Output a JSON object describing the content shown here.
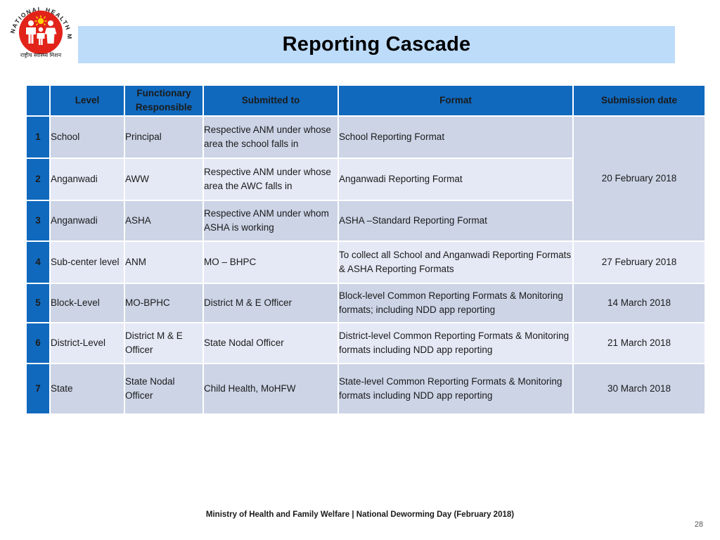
{
  "logo": {
    "name": "national-health-mission-logo",
    "arc_text": "NATIONAL HEALTH MISSION",
    "hindi_text": "राष्ट्रीय स्वास्थ्य मिशन",
    "colors": {
      "circle": "#e2231a",
      "figures": "#ffffff",
      "sun": "#ffd200"
    }
  },
  "slide": {
    "title": "Reporting Cascade",
    "title_band_color": "#bddcfa"
  },
  "table": {
    "header_color": "#1069bd",
    "row_shade_dark": "#ccd4e6",
    "row_shade_light": "#e5e9f5",
    "columns": [
      {
        "key": "num",
        "label": ""
      },
      {
        "key": "level",
        "label": "Level"
      },
      {
        "key": "functionary",
        "label": "Functionary Responsible"
      },
      {
        "key": "submitted_to",
        "label": "Submitted to"
      },
      {
        "key": "format",
        "label": "Format"
      },
      {
        "key": "submission_date",
        "label": "Submission date"
      }
    ],
    "rows": [
      {
        "num": "1",
        "level": "School",
        "functionary": "Principal",
        "submitted_to": "Respective ANM under whose area the school falls in",
        "format": "School Reporting Format",
        "submission_date": ""
      },
      {
        "num": "2",
        "level": "Anganwadi",
        "functionary": "AWW",
        "submitted_to": "Respective ANM under whose area the AWC falls in",
        "format": "Anganwadi Reporting Format",
        "submission_date": "20 February 2018"
      },
      {
        "num": "3",
        "level": "Anganwadi",
        "functionary": "ASHA",
        "submitted_to": "Respective ANM under whom  ASHA is working",
        "format": "ASHA –Standard Reporting Format",
        "submission_date": ""
      },
      {
        "num": "4",
        "level": "Sub-center level",
        "functionary": "ANM",
        "submitted_to": "MO – BHPC",
        "format": "To collect all School and Anganwadi Reporting Formats & ASHA Reporting Formats",
        "submission_date": "27 February  2018"
      },
      {
        "num": "5",
        "level": "Block-Level",
        "functionary": "MO-BPHC",
        "submitted_to": "District M & E Officer",
        "format": "Block-level Common Reporting Formats & Monitoring formats; including NDD app reporting",
        "submission_date": "14 March 2018"
      },
      {
        "num": "6",
        "level": "District-Level",
        "functionary": "District M & E Officer",
        "submitted_to": "State Nodal Officer",
        "format": "District-level Common Reporting Formats & Monitoring formats including NDD app reporting",
        "submission_date": "21 March 2018"
      },
      {
        "num": "7",
        "level": "State",
        "functionary": "State Nodal Officer",
        "submitted_to": "Child Health, MoHFW",
        "format": "State-level Common Reporting Formats & Monitoring formats including NDD app reporting",
        "submission_date": "30 March 2018"
      }
    ]
  },
  "footer": {
    "text": "Ministry of Health and Family Welfare | National Deworming Day (February 2018)",
    "page_number": "28"
  }
}
